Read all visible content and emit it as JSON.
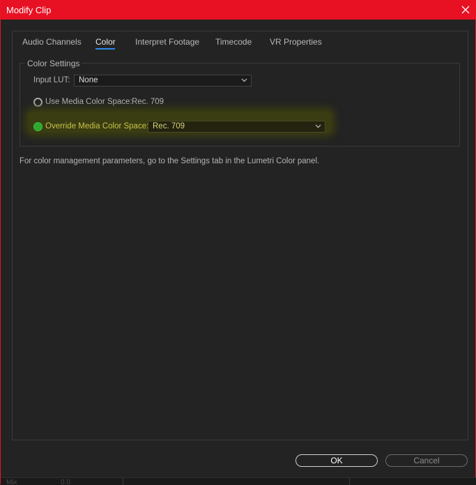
{
  "window": {
    "title": "Modify Clip"
  },
  "tabs": [
    {
      "label": "Audio Channels",
      "active": false
    },
    {
      "label": "Color",
      "active": true
    },
    {
      "label": "Interpret Footage",
      "active": false
    },
    {
      "label": "Timecode",
      "active": false
    },
    {
      "label": "VR Properties",
      "active": false
    }
  ],
  "color_settings": {
    "group_title": "Color Settings",
    "input_lut": {
      "label": "Input LUT:",
      "value": "None"
    },
    "use_media": {
      "label": "Use Media Color Space:",
      "value": "Rec. 709",
      "selected": false
    },
    "override_media": {
      "label": "Override Media Color Space:",
      "value": "Rec. 709",
      "selected": true
    }
  },
  "info_text": "For color management parameters, go to the Settings tab in the Lumetri Color panel.",
  "buttons": {
    "ok": "OK",
    "cancel": "Cancel"
  },
  "bottom_strip": {
    "text_left": "Mix",
    "text_mid": "0.0"
  },
  "colors": {
    "title_bar": "#e81123",
    "tab_underline": "#2d8ceb",
    "radio_selected": "#2fa82f",
    "highlight": "#3a3c12"
  },
  "icons": {
    "close": "close-icon",
    "dropdown": "chevron-down-icon"
  }
}
